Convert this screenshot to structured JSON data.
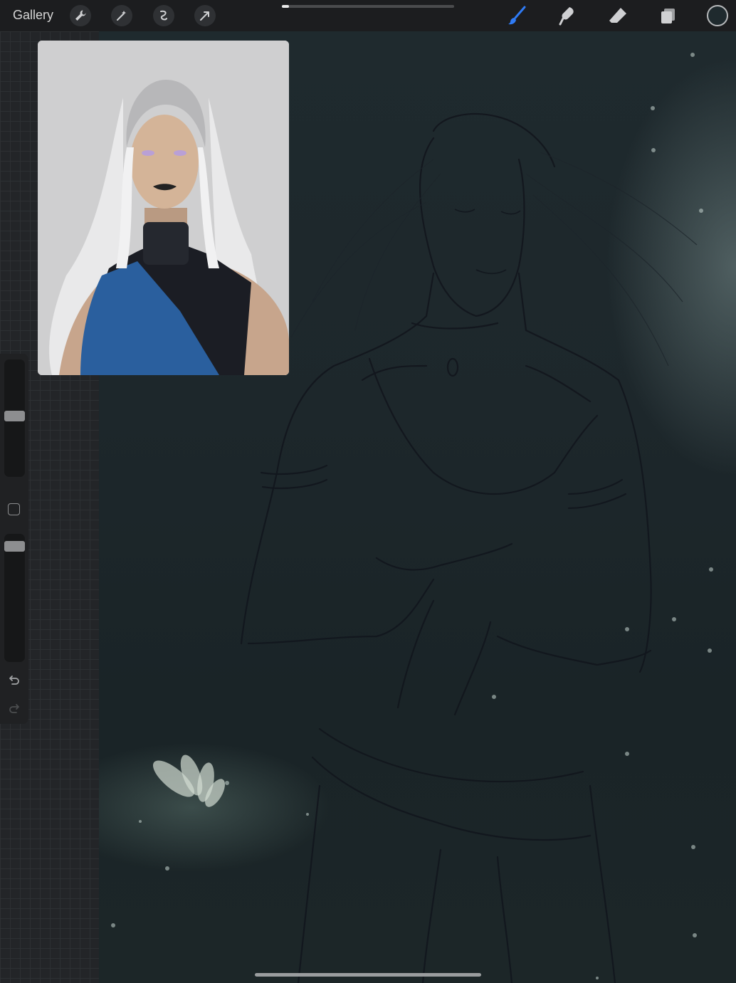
{
  "topbar": {
    "gallery_label": "Gallery",
    "left_tools": [
      "wrench-icon",
      "magic-wand-icon",
      "selection-icon",
      "transform-arrow-icon"
    ],
    "right_tools": [
      "brush-icon",
      "smudge-icon",
      "eraser-icon",
      "layers-icon"
    ],
    "active_tool": "brush-icon",
    "active_color": "#1f2a2e",
    "accent": "#2f7bf5"
  },
  "sidebar": {
    "brush_size_level": 0.52,
    "opacity_level": 0.94,
    "controls": [
      "modify-button",
      "undo-icon",
      "redo-icon"
    ]
  },
  "reference": {
    "name": "reference-image"
  }
}
